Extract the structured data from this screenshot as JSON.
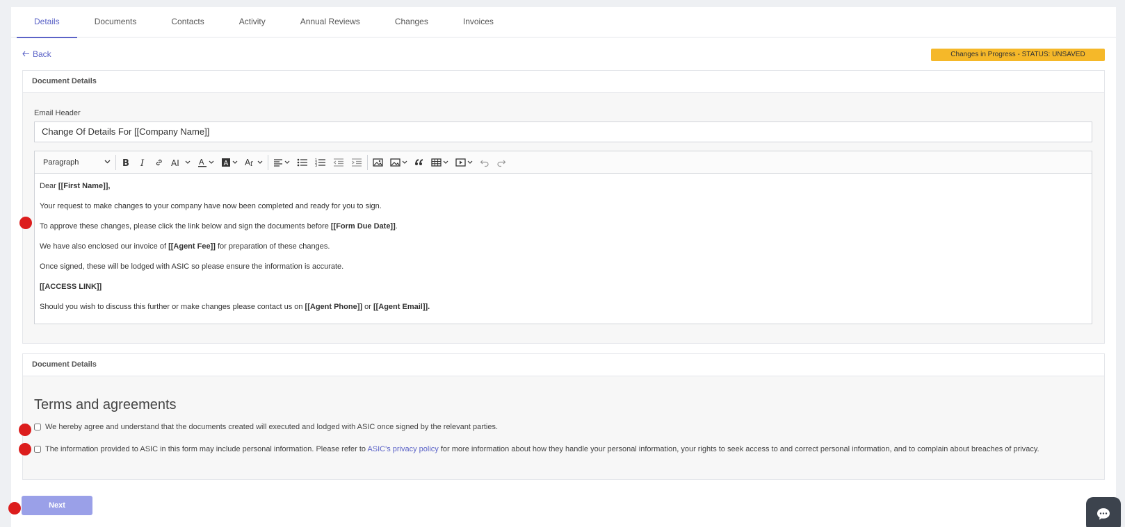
{
  "tabs": [
    {
      "label": "Details",
      "active": true
    },
    {
      "label": "Documents"
    },
    {
      "label": "Contacts"
    },
    {
      "label": "Activity"
    },
    {
      "label": "Annual Reviews"
    },
    {
      "label": "Changes"
    },
    {
      "label": "Invoices"
    }
  ],
  "back": {
    "label": "Back"
  },
  "status_badge": "Changes in Progress - STATUS: UNSAVED",
  "card1": {
    "header": "Document Details",
    "email_header_label": "Email Header",
    "email_header_value": "Change Of Details For [[Company Name]]",
    "toolbar": {
      "paragraph_style": "Paragraph"
    },
    "body": {
      "line1_a": "Dear ",
      "line1_b": "[[First Name]],",
      "line2": "Your request to make changes to your company have now been completed and ready for you to sign.",
      "line3_a": "To approve these changes, please click the link below and sign the documents before ",
      "line3_b": "[[Form Due Date]]",
      "line3_c": ".",
      "line4_a": "We have also enclosed our invoice of ",
      "line4_b": "[[Agent Fee]]",
      "line4_c": " for preparation of these changes.",
      "line5": "Once signed, these will be lodged with ASIC so please ensure the information is accurate.",
      "line6": "[[ACCESS LINK]]",
      "line7_a": "Should you wish to discuss this further or make changes please contact us on ",
      "line7_b": "[[Agent Phone]]",
      "line7_c": " or ",
      "line7_d": "[[Agent Email]]."
    }
  },
  "card2": {
    "header": "Document Details",
    "title": "Terms and agreements",
    "check1": "We hereby agree and understand that the documents created will executed and lodged with ASIC once signed by the relevant parties.",
    "check2_a": "The information provided to ASIC in this form may include personal information. Please refer to ",
    "check2_link": "ASIC's privacy policy",
    "check2_b": " for more information about how they handle your personal information, your rights to seek access to and correct personal information, and to complain about breaches of privacy."
  },
  "next_label": "Next",
  "colors": {
    "accent": "#5b63c7",
    "badge": "#f5b829",
    "next_button": "#9aa0e8",
    "marker": "#dc1d1d"
  }
}
